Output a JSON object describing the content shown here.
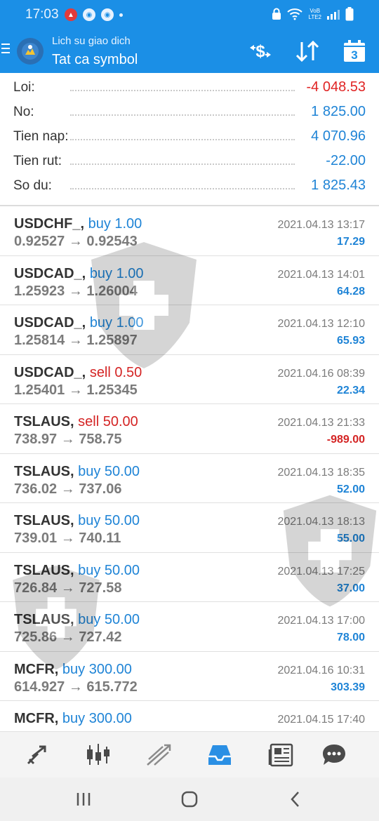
{
  "status_bar": {
    "time": "17:03",
    "network_line1": "VoB",
    "network_line2": "LTE2",
    "icons": [
      "brave-icon",
      "chrome-icon",
      "chrome-icon",
      "dot-icon",
      "lock-icon",
      "wifi-icon",
      "signal-icon",
      "battery-icon"
    ]
  },
  "header": {
    "subtitle": "Lich su giao dich",
    "title": "Tat ca symbol",
    "calendar_badge": "3",
    "icons": [
      "menu-icon",
      "app-logo",
      "currency-exchange-icon",
      "sort-icon",
      "calendar-icon"
    ],
    "accent_color": "#1b8fe6"
  },
  "summary": [
    {
      "label": "Loi:",
      "value": "-4 048.53",
      "negative": true
    },
    {
      "label": "No:",
      "value": "1 825.00",
      "negative": false
    },
    {
      "label": "Tien nap:",
      "value": "4 070.96",
      "negative": false
    },
    {
      "label": "Tien rut:",
      "value": "-22.00",
      "negative": false
    },
    {
      "label": "So du:",
      "value": "1 825.43",
      "negative": false
    }
  ],
  "trades": [
    {
      "symbol": "USDCHF_,",
      "side": "buy 1.00",
      "type": "buy",
      "prices": "0.92527 → 0.92543",
      "date": "2021.04.13 13:17",
      "profit": "17.29",
      "negative": false
    },
    {
      "symbol": "USDCAD_,",
      "side": "buy 1.00",
      "type": "buy",
      "prices": "1.25923 → 1.26004",
      "date": "2021.04.13 14:01",
      "profit": "64.28",
      "negative": false
    },
    {
      "symbol": "USDCAD_,",
      "side": "buy 1.00",
      "type": "buy",
      "prices": "1.25814 → 1.25897",
      "date": "2021.04.13 12:10",
      "profit": "65.93",
      "negative": false
    },
    {
      "symbol": "USDCAD_,",
      "side": "sell 0.50",
      "type": "sell",
      "prices": "1.25401 → 1.25345",
      "date": "2021.04.16 08:39",
      "profit": "22.34",
      "negative": false
    },
    {
      "symbol": "TSLAUS,",
      "side": "sell 50.00",
      "type": "sell",
      "prices": "738.97 → 758.75",
      "date": "2021.04.13 21:33",
      "profit": "-989.00",
      "negative": true
    },
    {
      "symbol": "TSLAUS,",
      "side": "buy 50.00",
      "type": "buy",
      "prices": "736.02 → 737.06",
      "date": "2021.04.13 18:35",
      "profit": "52.00",
      "negative": false
    },
    {
      "symbol": "TSLAUS,",
      "side": "buy 50.00",
      "type": "buy",
      "prices": "739.01 → 740.11",
      "date": "2021.04.13 18:13",
      "profit": "55.00",
      "negative": false
    },
    {
      "symbol": "TSLAUS,",
      "side": "buy 50.00",
      "type": "buy",
      "prices": "726.84 → 727.58",
      "date": "2021.04.13 17:25",
      "profit": "37.00",
      "negative": false
    },
    {
      "symbol": "TSLAUS,",
      "side": "buy 50.00",
      "type": "buy",
      "prices": "725.86 → 727.42",
      "date": "2021.04.13 17:00",
      "profit": "78.00",
      "negative": false
    },
    {
      "symbol": "MCFR,",
      "side": "buy 300.00",
      "type": "buy",
      "prices": "614.927 → 615.772",
      "date": "2021.04.16 10:31",
      "profit": "303.39",
      "negative": false
    },
    {
      "symbol": "MCFR,",
      "side": "buy 300.00",
      "type": "buy",
      "prices": "",
      "date": "2021.04.15 17:40",
      "profit": "",
      "negative": false
    }
  ],
  "bottom_nav": [
    "trade-icon",
    "chart-icon",
    "trade-arrows-icon",
    "history-inbox-icon",
    "news-icon",
    "chat-icon"
  ],
  "colors": {
    "buy": "#1f84d6",
    "sell": "#d42424",
    "negative": "#e02424"
  }
}
